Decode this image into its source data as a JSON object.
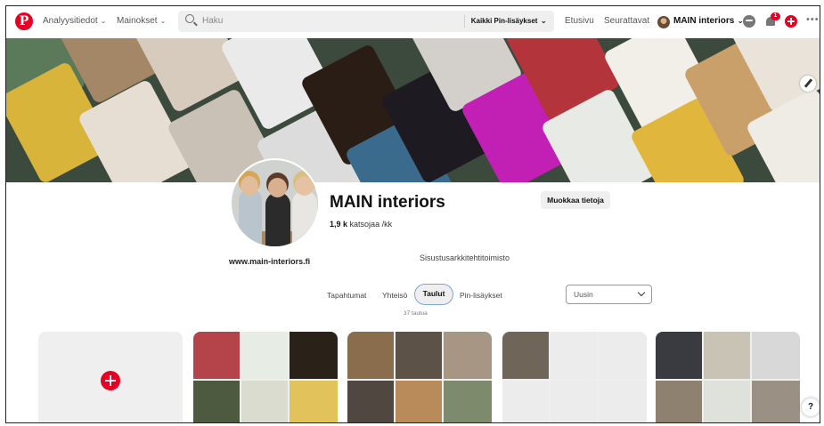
{
  "header": {
    "logo": "P",
    "nav": [
      "Analyysitiedot",
      "Mainokset"
    ],
    "search_placeholder": "Haku",
    "search_filter": "Kaikki Pin-lisäykset",
    "links": [
      "Etusivu",
      "Seurattavat"
    ],
    "profile_name": "MAIN interiors",
    "notification_badge": "1",
    "more": "•••"
  },
  "profile": {
    "name": "MAIN interiors",
    "followers_count": "1,9 k",
    "followers_label": "katsojaa /kk",
    "edit_button": "Muokkaa tietoja",
    "website": "www.main-interiors.fi",
    "about": "Sisustusarkkitehtitoimisto"
  },
  "tabs": [
    "Tapahtumat",
    "Yhteisö",
    "Taulut",
    "Pin-lisäykset"
  ],
  "active_tab": "Taulut",
  "board_count": "37 taulua",
  "sort": {
    "value": "Uusin"
  },
  "help": "?",
  "colors": {
    "brand": "#e60023",
    "tab_focus": "#7aa6d8"
  }
}
